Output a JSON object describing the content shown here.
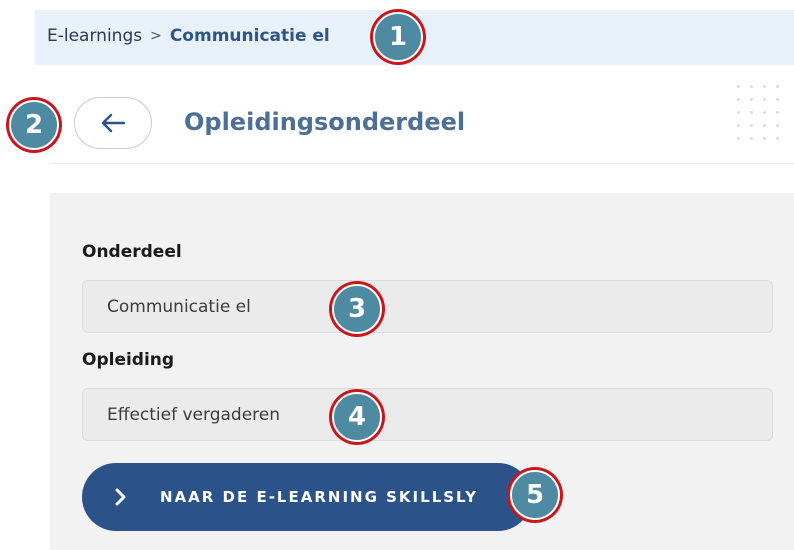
{
  "breadcrumb": {
    "root": "E-learnings",
    "separator": ">",
    "current": "Communicatie el"
  },
  "header": {
    "back_icon": "arrow-left-icon",
    "title": "Opleidingsonderdeel"
  },
  "form": {
    "onderdeel_label": "Onderdeel",
    "onderdeel_value": "Communicatie el",
    "opleiding_label": "Opleiding",
    "opleiding_value": "Effectief vergaderen"
  },
  "cta": {
    "icon": "chevron-right-icon",
    "label": "NAAR DE E-LEARNING SKILLSLY"
  },
  "markers": [
    "1",
    "2",
    "3",
    "4",
    "5"
  ],
  "colors": {
    "accent": "#2c5389",
    "title": "#4d6f96",
    "breadcrumb_bg": "#e8f0fa",
    "marker_fill": "#4f8aa3",
    "marker_ring": "#c8161c"
  }
}
